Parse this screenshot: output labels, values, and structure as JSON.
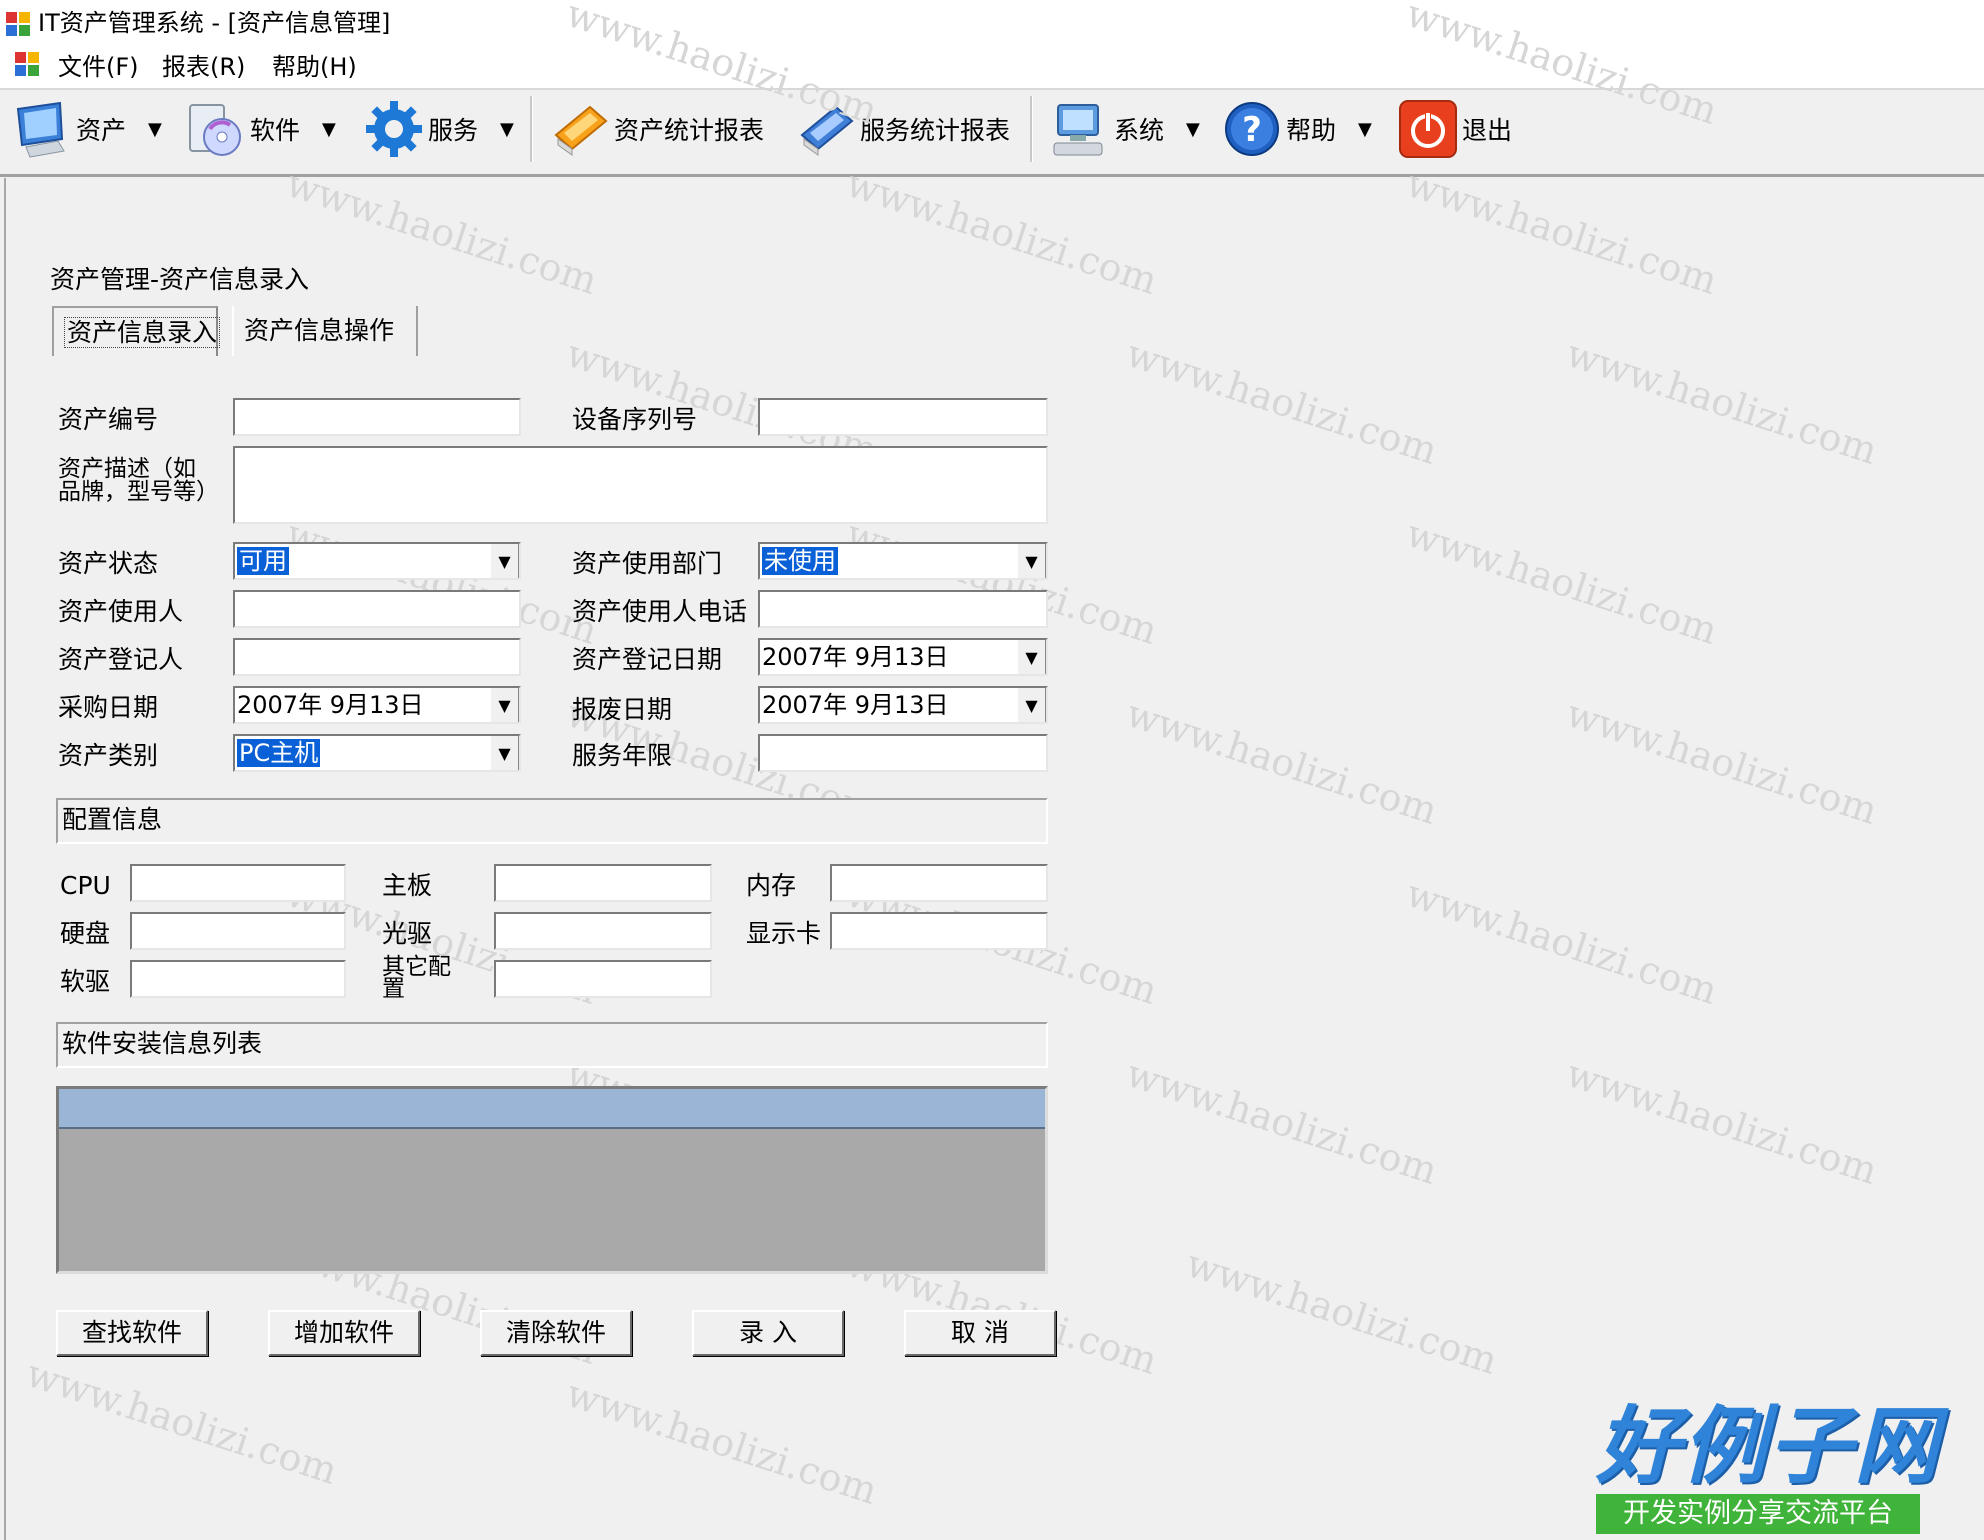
{
  "window": {
    "title": "IT资产管理系统 - [资产信息管理]"
  },
  "menu": {
    "items": [
      "文件(F)",
      "报表(R)",
      "帮助(H)"
    ]
  },
  "toolbar": {
    "asset": "资产",
    "software": "软件",
    "service": "服务",
    "asset_report": "资产统计报表",
    "service_report": "服务统计报表",
    "system": "系统",
    "help": "帮助",
    "exit": "退出",
    "dropdown_caret": "▼"
  },
  "breadcrumb": "资产管理-资产信息录入",
  "tabs": {
    "entry": "资产信息录入",
    "operations": "资产信息操作"
  },
  "form": {
    "asset_no": {
      "label": "资产编号",
      "value": ""
    },
    "serial_no": {
      "label": "设备序列号",
      "value": ""
    },
    "description": {
      "label": "资产描述（如品牌，型号等）",
      "value": ""
    },
    "status": {
      "label": "资产状态",
      "value": "可用"
    },
    "department": {
      "label": "资产使用部门",
      "value": "未使用"
    },
    "user": {
      "label": "资产使用人",
      "value": ""
    },
    "user_phone": {
      "label": "资产使用人电话",
      "value": ""
    },
    "registrar": {
      "label": "资产登记人",
      "value": ""
    },
    "register_date": {
      "label": "资产登记日期",
      "value": "2007年  9月13日"
    },
    "purchase_date": {
      "label": "采购日期",
      "value": "2007年  9月13日"
    },
    "scrap_date": {
      "label": "报废日期",
      "value": "2007年  9月13日"
    },
    "category": {
      "label": "资产类别",
      "value": "PC主机"
    },
    "service_years": {
      "label": "服务年限",
      "value": ""
    }
  },
  "config": {
    "title": "配置信息",
    "cpu": "CPU",
    "motherboard": "主板",
    "memory": "内存",
    "hard_disk": "硬盘",
    "optical_drive": "光驱",
    "video_card": "显示卡",
    "floppy_drive": "软驱",
    "other": "其它配置"
  },
  "software_list": {
    "title": "软件安装信息列表"
  },
  "buttons": {
    "find_software": "查找软件",
    "add_software": "增加软件",
    "clear_software": "清除软件",
    "submit": "录 入",
    "cancel": "取 消"
  },
  "watermark": {
    "text": "www.haolizi.com",
    "brand": "好例子网",
    "tagline": "开发实例分享交流平台"
  }
}
